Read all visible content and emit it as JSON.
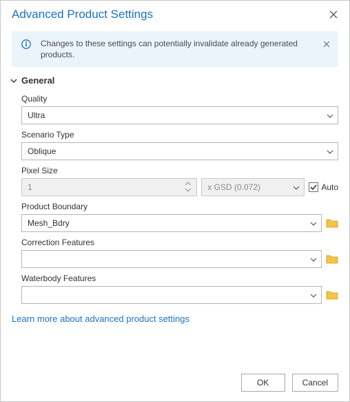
{
  "dialog": {
    "title": "Advanced Product Settings"
  },
  "notice": {
    "text": "Changes to these settings can potentially invalidate already generated products."
  },
  "section_general": {
    "title": "General",
    "quality": {
      "label": "Quality",
      "value": "Ultra"
    },
    "scenario_type": {
      "label": "Scenario Type",
      "value": "Oblique"
    },
    "pixel_size": {
      "label": "Pixel Size",
      "value": "1",
      "unit_value": "x GSD (0.072)",
      "auto_label": "Auto",
      "auto_checked": true
    },
    "product_boundary": {
      "label": "Product Boundary",
      "value": "Mesh_Bdry"
    },
    "correction_features": {
      "label": "Correction Features",
      "value": ""
    },
    "waterbody_features": {
      "label": "Waterbody Features",
      "value": ""
    }
  },
  "link": {
    "learn_more": "Learn more about advanced product settings"
  },
  "footer": {
    "ok": "OK",
    "cancel": "Cancel"
  }
}
